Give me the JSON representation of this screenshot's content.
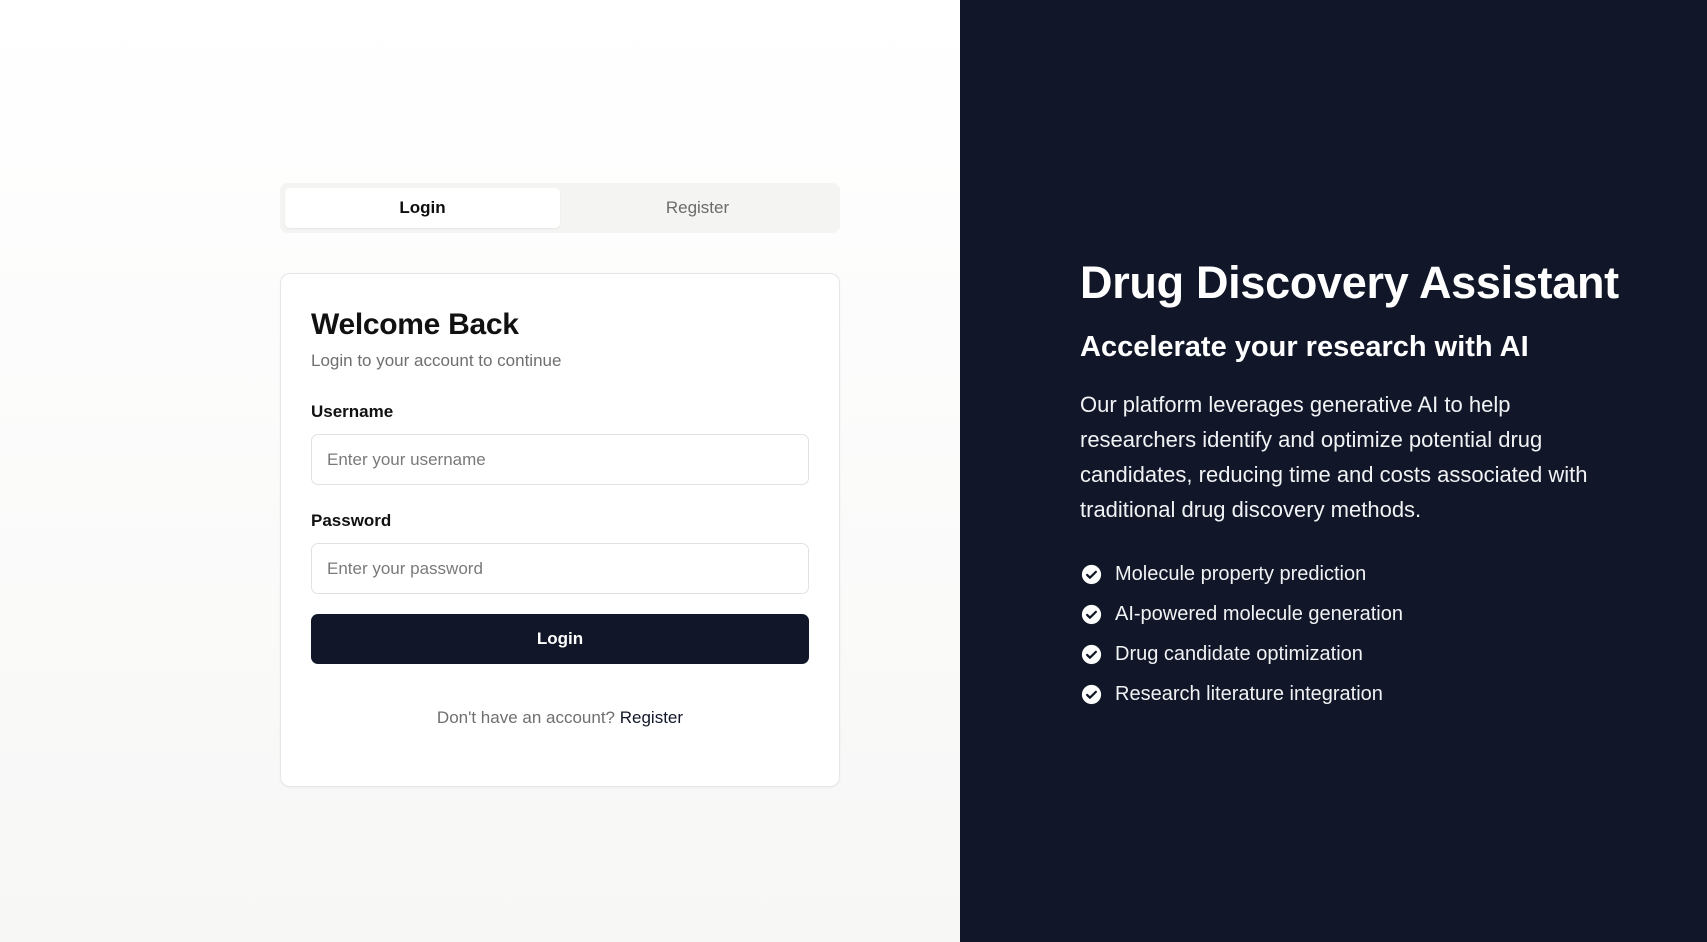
{
  "tabs": {
    "login_label": "Login",
    "register_label": "Register"
  },
  "card": {
    "title": "Welcome Back",
    "subtitle": "Login to your account to continue",
    "username_label": "Username",
    "username_placeholder": "Enter your username",
    "password_label": "Password",
    "password_placeholder": "Enter your password",
    "submit_label": "Login",
    "footer_text": "Don't have an account?",
    "footer_link": "Register"
  },
  "hero": {
    "title": "Drug Discovery Assistant",
    "subtitle": "Accelerate your research with AI",
    "description": "Our platform leverages generative AI to help researchers identify and optimize potential drug candidates, reducing time and costs associated with traditional drug discovery methods.",
    "features": [
      {
        "label": "Molecule property prediction",
        "icon": "check-circle-icon"
      },
      {
        "label": "AI-powered molecule generation",
        "icon": "check-circle-icon"
      },
      {
        "label": "Drug candidate optimization",
        "icon": "check-circle-icon"
      },
      {
        "label": "Research literature integration",
        "icon": "check-circle-icon"
      }
    ]
  },
  "colors": {
    "dark_navy": "#111729",
    "tab_bg": "#f4f4f3",
    "muted_text": "#6f6f6f"
  }
}
